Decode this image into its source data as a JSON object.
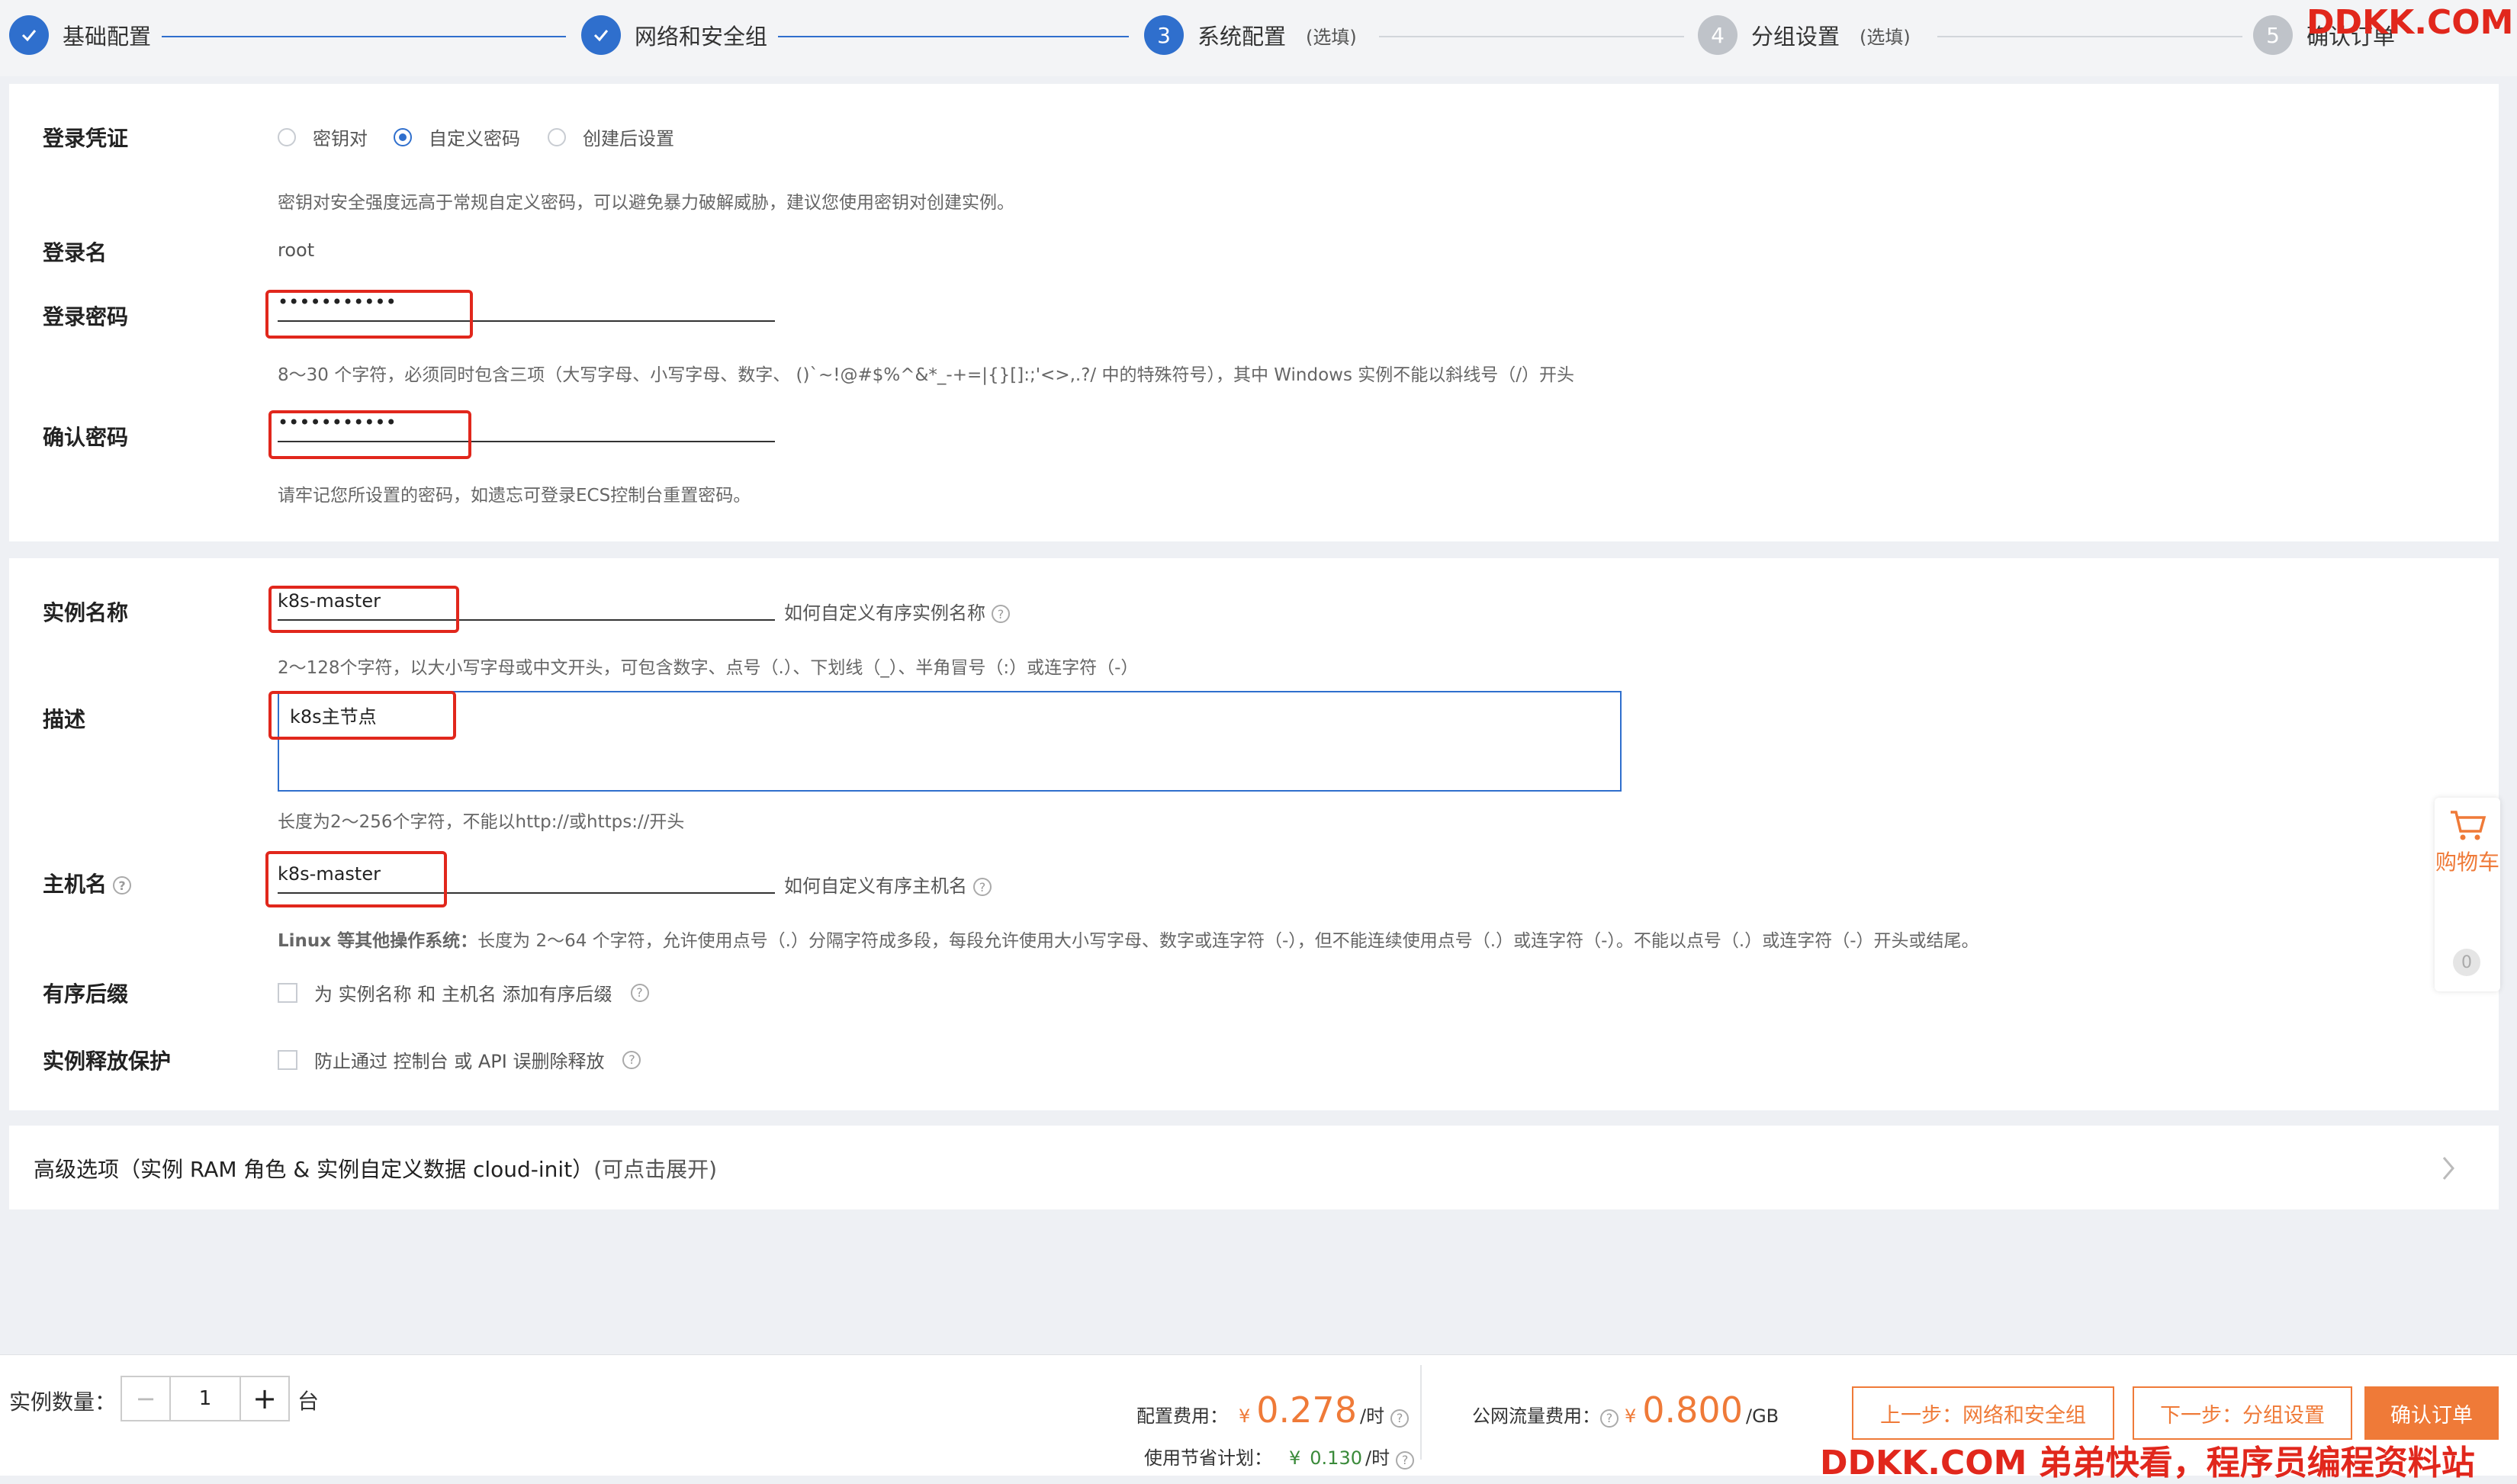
{
  "steps": [
    {
      "label": "基础配置",
      "number": "1",
      "sub": ""
    },
    {
      "label": "网络和安全组",
      "number": "2",
      "sub": ""
    },
    {
      "label": "系统配置",
      "number": "3",
      "sub": "(选填)"
    },
    {
      "label": "分组设置",
      "number": "4",
      "sub": "(选填)"
    },
    {
      "label": "确认订单",
      "number": "5",
      "sub": ""
    }
  ],
  "login": {
    "credential_label": "登录凭证",
    "options": [
      "密钥对",
      "自定义密码",
      "创建后设置"
    ],
    "selected_option": "自定义密码",
    "tip": "密钥对安全强度远高于常规自定义密码，可以避免暴力破解威胁，建议您使用密钥对创建实例。",
    "username_label": "登录名",
    "username": "root",
    "password_label": "登录密码",
    "password_value": "•••••••••••",
    "password_hint": "8～30 个字符，必须同时包含三项（大写字母、小写字母、数字、 ()`~!@#$%^&*_-+=|{}[]:;'<>,.?/ 中的特殊符号），其中 Windows 实例不能以斜线号（/）开头",
    "confirm_label": "确认密码",
    "confirm_value": "•••••••••••",
    "confirm_hint": "请牢记您所设置的密码，如遗忘可登录ECS控制台重置密码。"
  },
  "instance": {
    "name_label": "实例名称",
    "name_value": "k8s-master",
    "name_help": "如何自定义有序实例名称",
    "name_hint": "2～128个字符，以大小写字母或中文开头，可包含数字、点号（.）、下划线（_）、半角冒号（:）或连字符（-）",
    "desc_label": "描述",
    "desc_value": "k8s主节点",
    "desc_hint": "长度为2～256个字符，不能以http://或https://开头",
    "host_label": "主机名",
    "host_value": "k8s-master",
    "host_help": "如何自定义有序主机名",
    "host_hint_bold": "Linux 等其他操作系统：",
    "host_hint": "长度为 2～64 个字符，允许使用点号（.）分隔字符成多段，每段允许使用大小写字母、数字或连字符（-），但不能连续使用点号（.）或连字符（-）。不能以点号（.）或连字符（-）开头或结尾。",
    "suffix_label": "有序后缀",
    "suffix_text": "为 实例名称 和 主机名 添加有序后缀",
    "protect_label": "实例释放保护",
    "protect_text": "防止通过 控制台 或 API 误删除释放"
  },
  "advanced": {
    "title": "高级选项（实例 RAM 角色 & 实例自定义数据 cloud-init）",
    "expand_hint": "(可点击展开)"
  },
  "cart": {
    "label": "购物车",
    "count": "0"
  },
  "footer": {
    "qty_label": "实例数量：",
    "qty_value": "1",
    "qty_unit": "台",
    "config_label": "配置费用：",
    "config_currency": "¥",
    "config_price": "0.278",
    "config_unit": "/时",
    "save_label": "使用节省计划：",
    "save_currency": "¥",
    "save_price": "0.130",
    "save_unit": "/时",
    "traffic_label": "公网流量费用：",
    "traffic_currency": "¥",
    "traffic_price": "0.800",
    "traffic_unit": "/GB",
    "prev_button": "上一步：网络和安全组",
    "next_button": "下一步：分组设置",
    "confirm_button": "确认订单"
  },
  "watermark": {
    "top": "DDKK.COM",
    "bottom": "DDKK.COM 弟弟快看，程序员编程资料站"
  },
  "colors": {
    "accent": "#2f6fcd",
    "orange": "#ef7a38",
    "red": "#e1271c",
    "green": "#3a8a3a"
  }
}
